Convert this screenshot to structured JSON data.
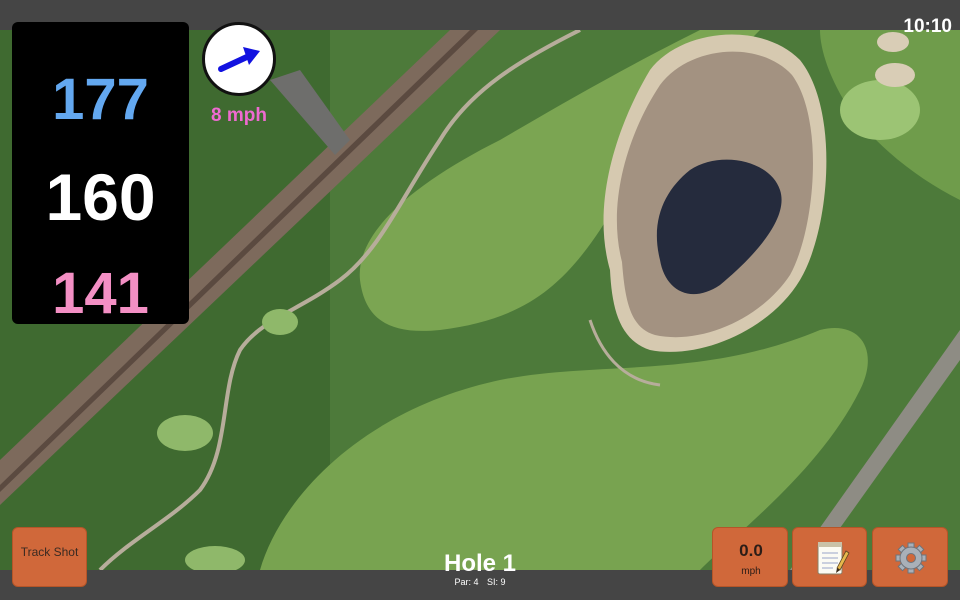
{
  "status_bar": {
    "time": "10:10"
  },
  "distances": {
    "back": "177",
    "middle": "160",
    "front": "141"
  },
  "wind": {
    "speed": "8 mph",
    "direction_icon": "wind-arrow-icon"
  },
  "buttons": {
    "track_shot": "Track Shot",
    "shot_speed": {
      "value": "0.0",
      "unit": "mph"
    },
    "notes_icon": "notepad-icon",
    "settings_icon": "gear-icon"
  },
  "hole": {
    "title": "Hole 1",
    "par": "Par: 4",
    "stroke_index": "SI: 9"
  },
  "colors": {
    "back_distance": "#63a8f0",
    "middle_distance": "#ffffff",
    "front_distance": "#f38fc4",
    "wind_text": "#ef6ad1",
    "button": "#d0683a"
  }
}
